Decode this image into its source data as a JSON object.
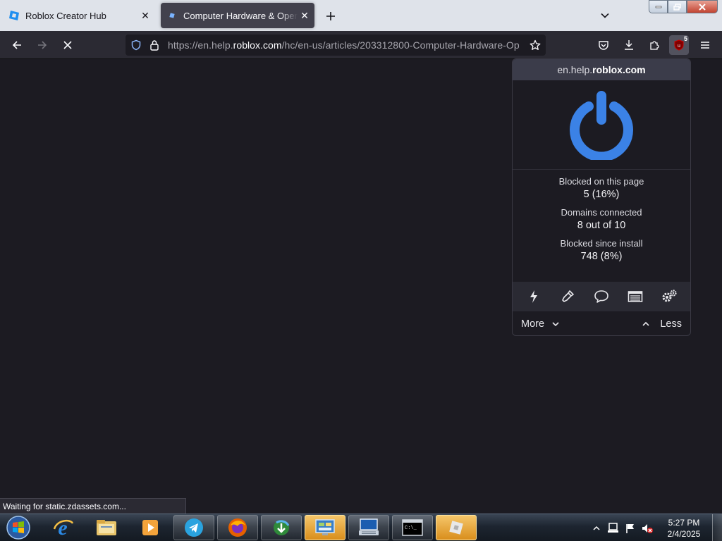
{
  "tabs": [
    {
      "title": "Roblox Creator Hub",
      "icon": "roblox-studio-icon",
      "active": false
    },
    {
      "title": "Computer Hardware & Operating",
      "icon": "roblox-icon",
      "active": true
    }
  ],
  "toolbar": {
    "url_prefix": "https://en.help.",
    "url_host": "roblox.com",
    "url_path": "/hc/en-us/articles/203312800-Computer-Hardware-Op",
    "ublock_badge": "5"
  },
  "ublock_popup": {
    "hostname_prefix": "en.help.",
    "hostname_domain": "roblox.com",
    "stats": [
      {
        "label": "Blocked on this page",
        "value": "5 (16%)"
      },
      {
        "label": "Domains connected",
        "value": "8 out of 10"
      },
      {
        "label": "Blocked since install",
        "value": "748 (8%)"
      }
    ],
    "tools": [
      "lightning-icon",
      "eyedropper-icon",
      "speech-bubble-icon",
      "logger-icon",
      "gears-icon"
    ],
    "more_label": "More",
    "less_label": "Less",
    "power_color": "#3b82e6"
  },
  "status_text": "Waiting for static.zdassets.com...",
  "taskbar": {
    "apps": [
      "internet-explorer-icon",
      "file-explorer-icon",
      "media-player-icon",
      "telegram-icon",
      "firefox-icon",
      "download-manager-icon",
      "control-panel-icon",
      "remote-desktop-icon",
      "command-prompt-icon",
      "roblox-icon"
    ],
    "clock_time": "5:27 PM",
    "clock_date": "2/4/2025"
  }
}
